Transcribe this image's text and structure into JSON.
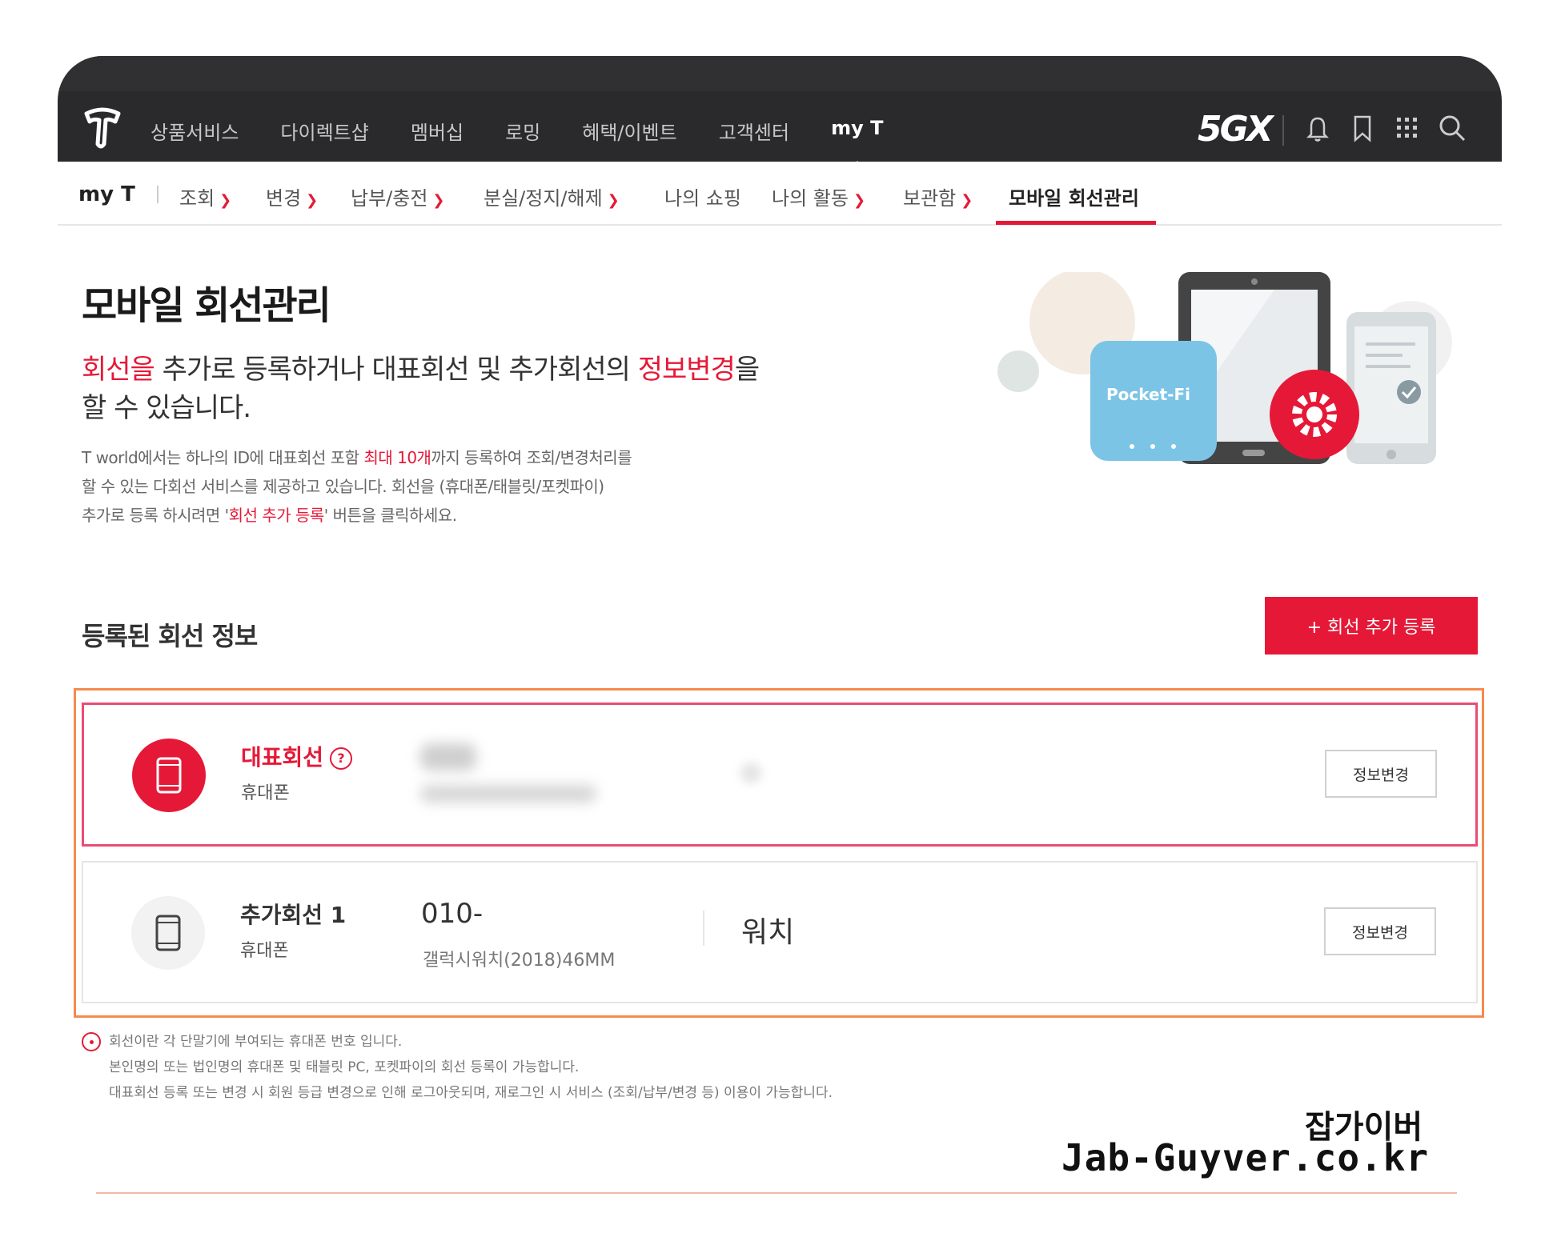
{
  "gnb": {
    "items": [
      "상품서비스",
      "다이렉트샵",
      "멤버십",
      "로밍",
      "혜택/이벤트",
      "고객센터",
      "my T"
    ],
    "brand": "5GX"
  },
  "subnav": {
    "home": "my T",
    "items": [
      {
        "label": "조회",
        "has_dropdown": true
      },
      {
        "label": "변경",
        "has_dropdown": true
      },
      {
        "label": "납부/충전",
        "has_dropdown": true
      },
      {
        "label": "분실/정지/해제",
        "has_dropdown": true
      },
      {
        "label": "나의 쇼핑",
        "has_dropdown": false
      },
      {
        "label": "나의 활동",
        "has_dropdown": true
      },
      {
        "label": "보관함",
        "has_dropdown": true
      },
      {
        "label": "모바일 회선관리",
        "has_dropdown": false,
        "current": true
      }
    ]
  },
  "hero": {
    "title": "모바일 회선관리",
    "lead_red1": "회선을",
    "lead_mid": " 추가로 등록하거나 대표회선 및 추가회선의 ",
    "lead_red2": "정보변경",
    "lead_end": "을",
    "lead_line2": "할 수 있습니다.",
    "desc_part1": "T world에서는 하나의 ID에 대표회선 포함 ",
    "desc_red1": "최대 10개",
    "desc_part2": "까지 등록하여 조회/변경처리를",
    "desc_line2": "할 수 있는 다회선 서비스를 제공하고 있습니다. 회선을 (휴대폰/태블릿/포켓파이)",
    "desc_part3": "추가로 등록 하시려면 '",
    "desc_red2": "회선 추가 등록",
    "desc_part4": "' 버튼을 클릭하세요.",
    "illustration_label": "Pocket-Fi"
  },
  "registered": {
    "title": "등록된 회선 정보",
    "add_button": "+ 회선 추가 등록",
    "lines": [
      {
        "label": "대표회선",
        "help": "?",
        "type": "휴대폰",
        "button": "정보변경"
      },
      {
        "label": "추가회선 1",
        "type": "휴대폰",
        "number": "010-",
        "model": "갤럭시워치(2018)46MM",
        "nickname": "워치",
        "button": "정보변경"
      }
    ]
  },
  "notes": [
    "회선이란 각 단말기에 부여되는 휴대폰 번호 입니다.",
    "본인명의 또는 법인명의 휴대폰 및 태블릿 PC, 포켓파이의 회선 등록이 가능합니다.",
    "대표회선 등록 또는 변경 시 회원 등급 변경으로 인해 로그아웃되며, 재로그인 시 서비스 (조회/납부/변경 등) 이용이 가능합니다."
  ],
  "watermark": {
    "line1": "잡가이버",
    "line2": "Jab-Guyver.co.kr"
  },
  "colors": {
    "accent": "#e51937",
    "topbar": "#2a2a2c",
    "highlight": "#f58a4e",
    "pocketfi": "#7cc4e6"
  }
}
